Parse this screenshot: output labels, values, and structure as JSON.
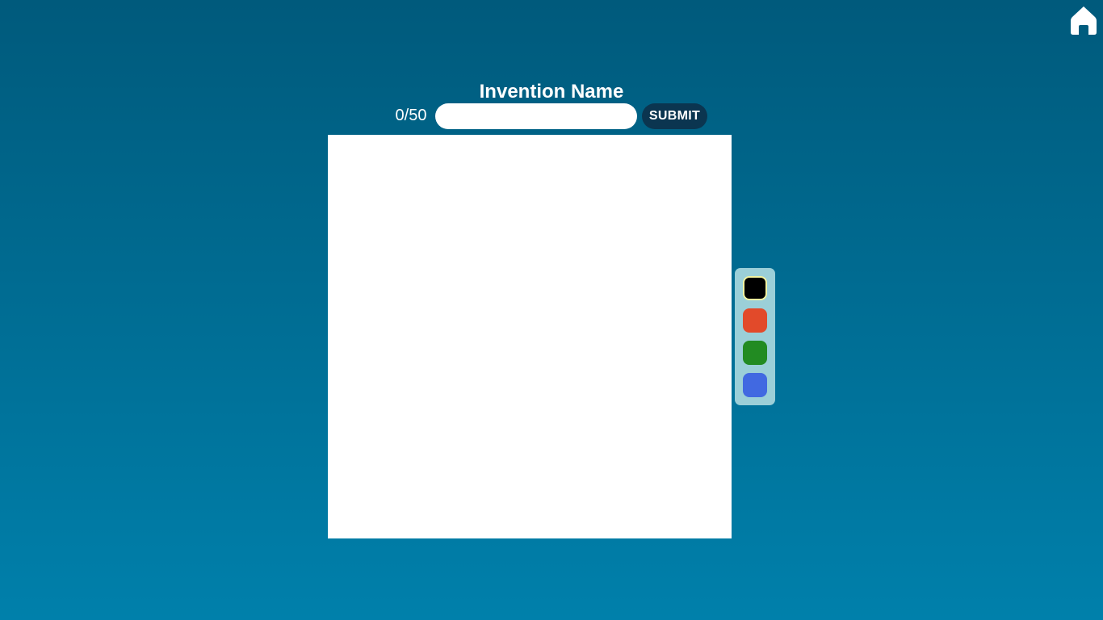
{
  "header": {
    "title": "Invention Name",
    "home_icon": "home-icon"
  },
  "name_form": {
    "counter": "0/50",
    "input_value": "",
    "input_placeholder": "",
    "submit_label": "SUBMIT"
  },
  "palette": {
    "selected": "black",
    "colors": [
      {
        "name": "black",
        "hex": "#000000"
      },
      {
        "name": "red",
        "hex": "#e24a2a"
      },
      {
        "name": "green",
        "hex": "#228b22"
      },
      {
        "name": "blue",
        "hex": "#4169e1"
      }
    ]
  },
  "theme": {
    "background_top": "#005a7c",
    "background_bottom": "#0080ab",
    "submit_bg": "#0b3550",
    "palette_bg": "#9bcfd8"
  }
}
